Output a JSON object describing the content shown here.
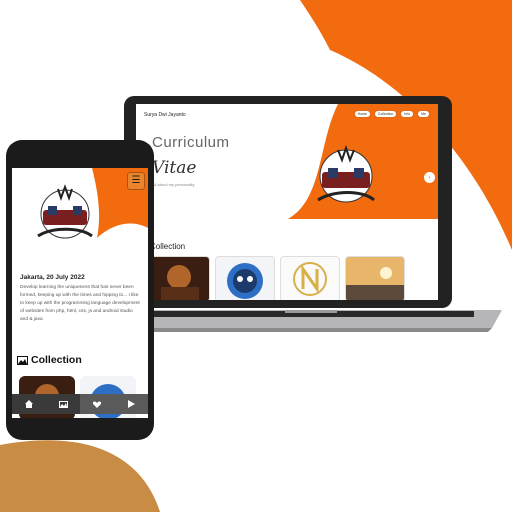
{
  "laptop": {
    "brand": "Surya Dwi Jayanto",
    "nav": [
      "Home",
      "Collection",
      "Info",
      "Me"
    ],
    "title_line1": "Curriculum",
    "title_line2": "Vitae",
    "subtitle": "All about my personality",
    "next_glyph": "›",
    "collection_heading": "Collection"
  },
  "phone": {
    "menu_glyph": "☰",
    "date": "Jakarta, 20 July 2022",
    "paragraph": "Develop learning the uniqueness that has never been formed, keeping up with the times and hipping to... I like to keep up with the programming language development of websites from php, html, css, js and android studio and & java",
    "collection_heading": "Collection",
    "bar_icons": [
      "home-icon",
      "image-icon",
      "heart-icon",
      "play-icon"
    ]
  },
  "colors": {
    "accent": "#f26b0f",
    "tan": "#c88c44"
  }
}
